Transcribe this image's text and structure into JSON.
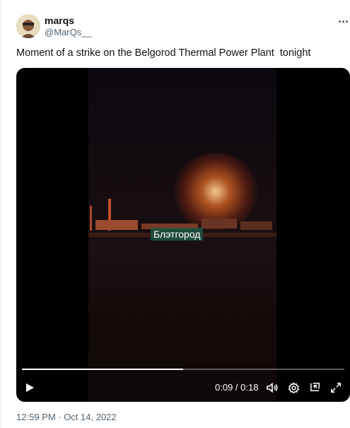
{
  "author": {
    "display_name": "marqs",
    "handle": "@MarQs__"
  },
  "tweet": {
    "text": "Moment of a strike on the Belgorod Thermal Power Plant  tonight",
    "timestamp": "12:59 PM · Oct 14, 2022"
  },
  "video": {
    "overlay_text": "Блэтгород",
    "current_time": "0:09",
    "duration": "0:18",
    "time_display": "0:09 / 0:18",
    "progress": 0.5
  },
  "icons": {
    "more": "more-icon",
    "play": "play-icon",
    "volume": "volume-icon",
    "settings": "settings-icon",
    "pip": "picture-in-picture-icon",
    "fullscreen": "fullscreen-icon"
  },
  "colors": {
    "text_primary": "#0f1419",
    "text_secondary": "#536471",
    "video_bg": "#000000"
  }
}
